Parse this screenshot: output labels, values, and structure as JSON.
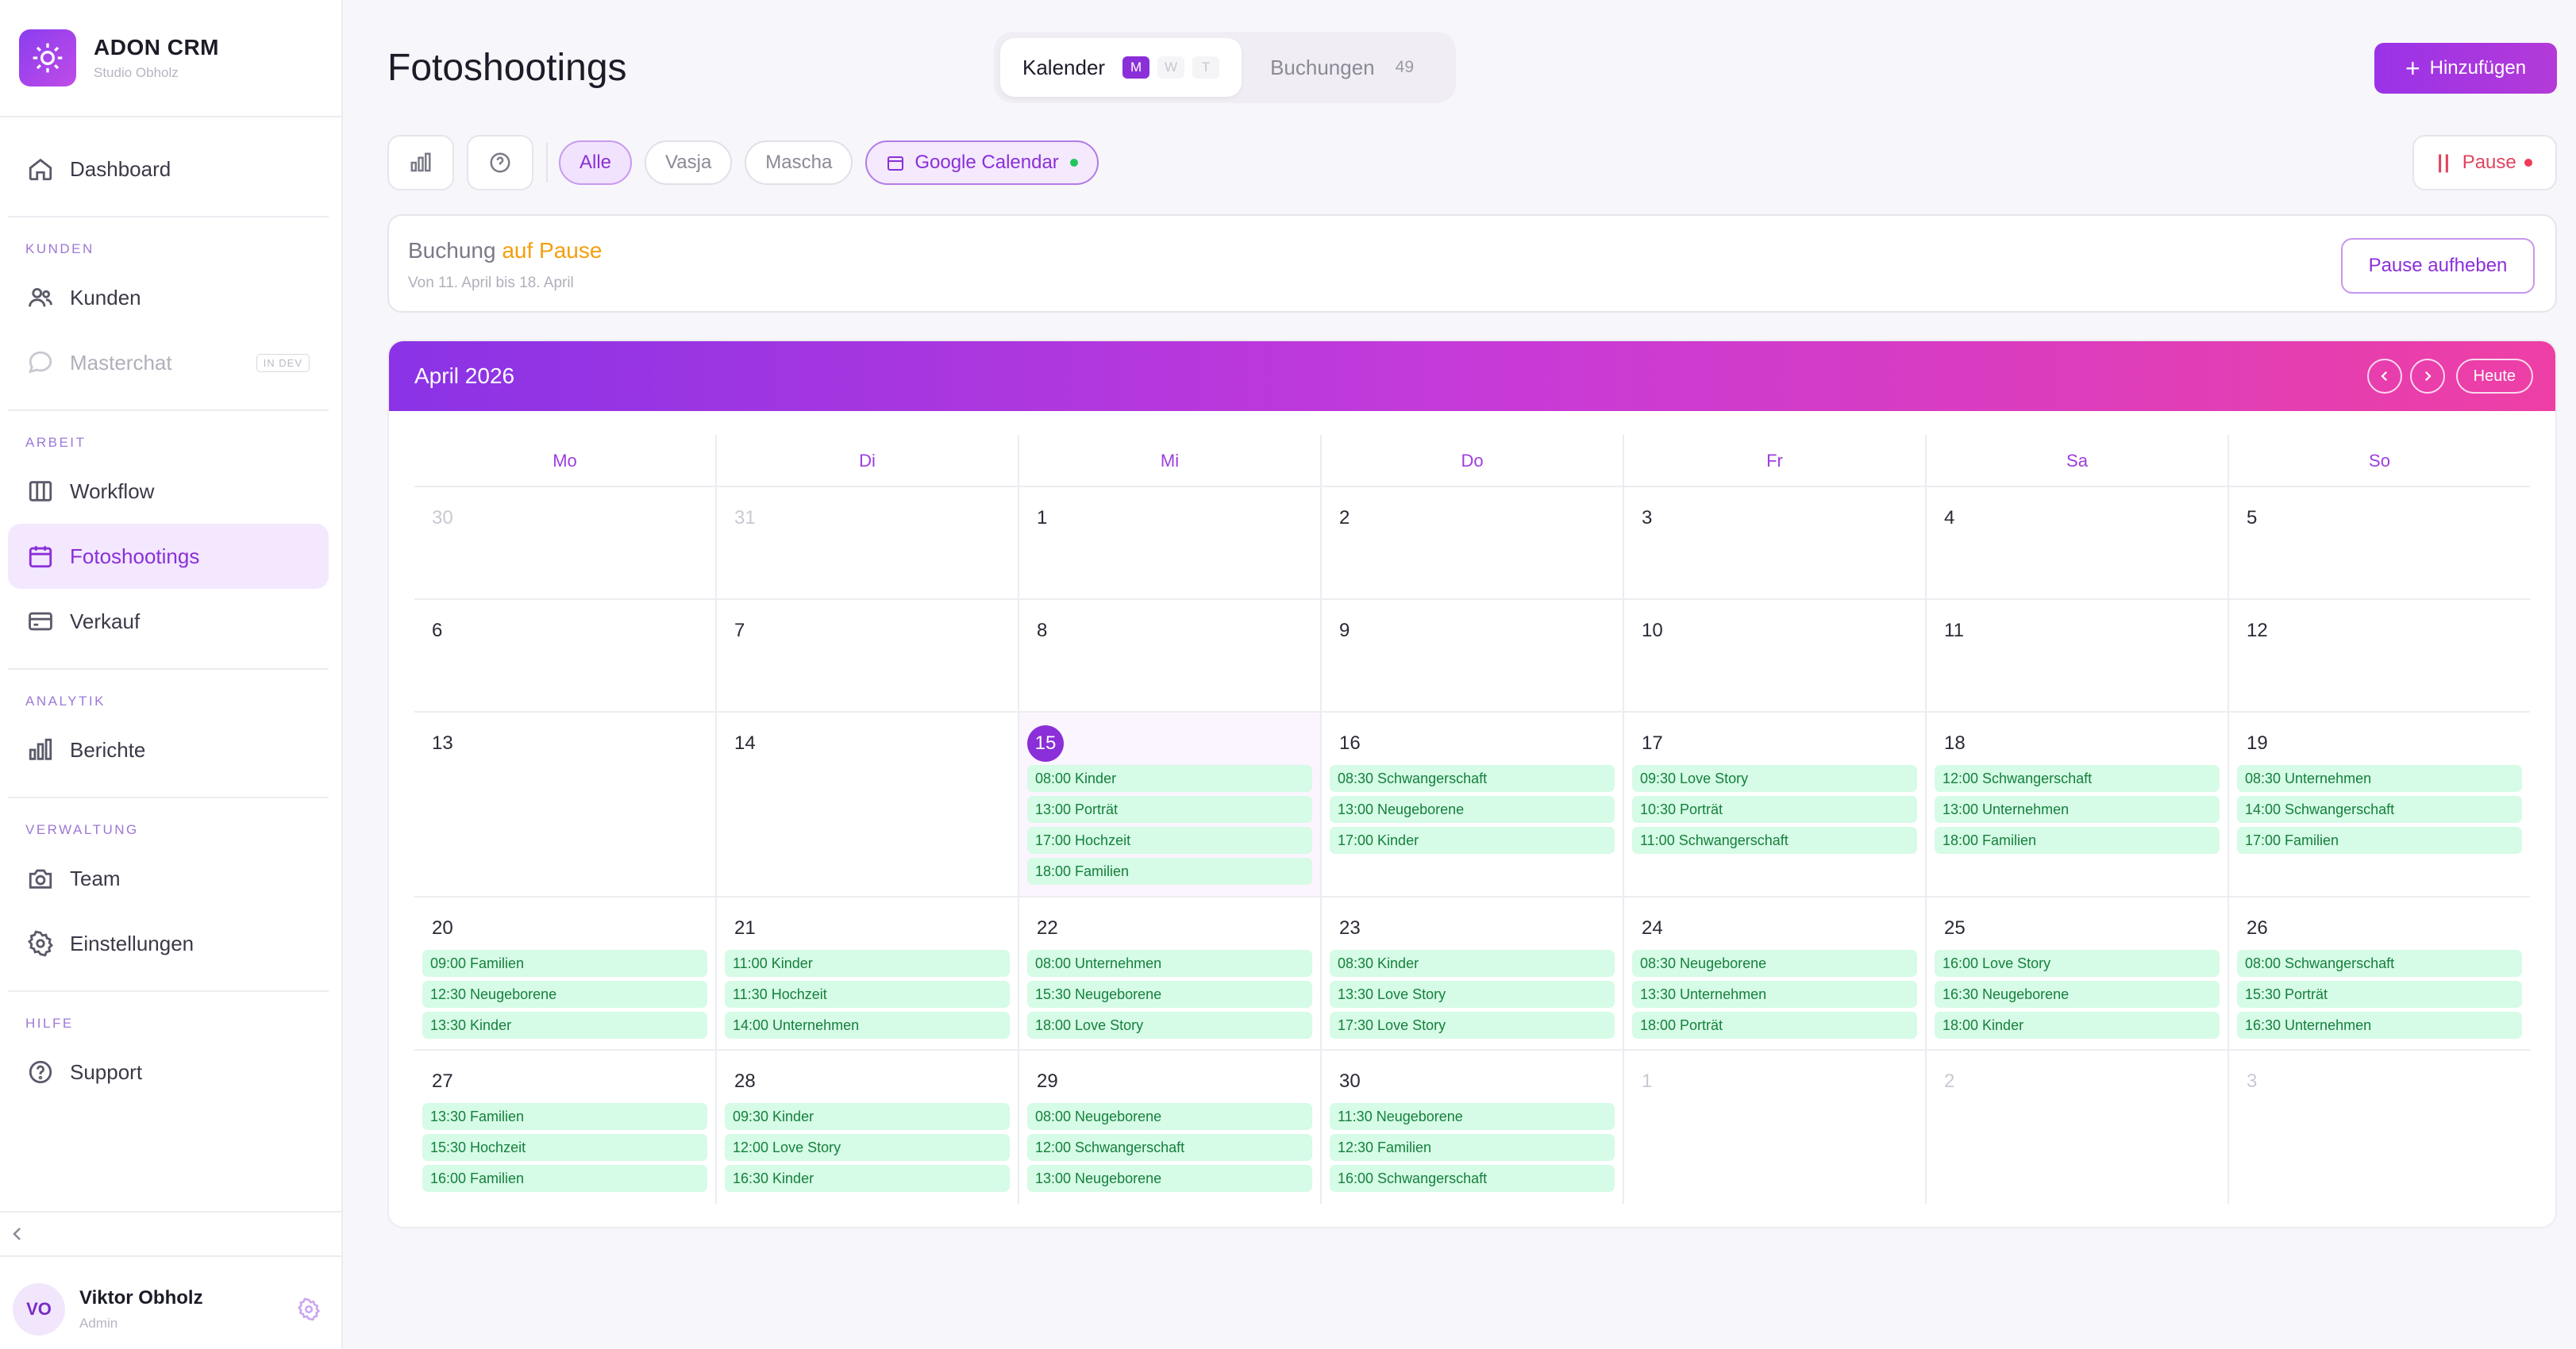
{
  "brand": {
    "title": "ADON CRM",
    "subtitle": "Studio Obholz"
  },
  "nav": {
    "dashboard": "Dashboard",
    "section_kunden": "KUNDEN",
    "kunden": "Kunden",
    "masterchat": "Masterchat",
    "masterchat_badge": "IN DEV",
    "section_arbeit": "ARBEIT",
    "workflow": "Workflow",
    "fotoshootings": "Fotoshootings",
    "verkauf": "Verkauf",
    "section_analytik": "ANALYTIK",
    "berichte": "Berichte",
    "section_verwaltung": "VERWALTUNG",
    "team": "Team",
    "einstellungen": "Einstellungen",
    "section_hilfe": "HILFE",
    "support": "Support"
  },
  "user": {
    "initials": "VO",
    "name": "Viktor Obholz",
    "role": "Admin"
  },
  "header": {
    "title": "Fotoshootings",
    "tab_calendar": "Kalender",
    "modes": [
      "M",
      "W",
      "T"
    ],
    "tab_bookings": "Buchungen",
    "bookings_count": "49",
    "add_button": "Hinzufügen"
  },
  "filters": {
    "all": "Alle",
    "vasja": "Vasja",
    "mascha": "Mascha",
    "gcal": "Google Calendar",
    "pause": "Pause"
  },
  "notice": {
    "prefix": "Buchung",
    "highlight": "auf Pause",
    "sub": "Von 11. April bis 18. April",
    "button": "Pause aufheben"
  },
  "calendar": {
    "month": "April 2026",
    "today_button": "Heute",
    "weekdays": [
      "Mo",
      "Di",
      "Mi",
      "Do",
      "Fr",
      "Sa",
      "So"
    ],
    "weeks": [
      [
        {
          "d": "30",
          "o": true,
          "ev": []
        },
        {
          "d": "31",
          "o": true,
          "ev": []
        },
        {
          "d": "1",
          "ev": []
        },
        {
          "d": "2",
          "ev": []
        },
        {
          "d": "3",
          "ev": []
        },
        {
          "d": "4",
          "ev": []
        },
        {
          "d": "5",
          "ev": []
        }
      ],
      [
        {
          "d": "6",
          "ev": []
        },
        {
          "d": "7",
          "ev": []
        },
        {
          "d": "8",
          "ev": []
        },
        {
          "d": "9",
          "ev": []
        },
        {
          "d": "10",
          "ev": []
        },
        {
          "d": "11",
          "ev": []
        },
        {
          "d": "12",
          "ev": []
        }
      ],
      [
        {
          "d": "13",
          "ev": []
        },
        {
          "d": "14",
          "ev": []
        },
        {
          "d": "15",
          "t": true,
          "ev": [
            "08:00 Kinder",
            "13:00 Porträt",
            "17:00 Hochzeit",
            "18:00 Familien"
          ]
        },
        {
          "d": "16",
          "ev": [
            "08:30 Schwangerschaft",
            "13:00 Neugeborene",
            "17:00 Kinder"
          ]
        },
        {
          "d": "17",
          "ev": [
            "09:30 Love Story",
            "10:30 Porträt",
            "11:00 Schwangerschaft"
          ]
        },
        {
          "d": "18",
          "ev": [
            "12:00 Schwangerschaft",
            "13:00 Unternehmen",
            "18:00 Familien"
          ]
        },
        {
          "d": "19",
          "ev": [
            "08:30 Unternehmen",
            "14:00 Schwangerschaft",
            "17:00 Familien"
          ]
        }
      ],
      [
        {
          "d": "20",
          "ev": [
            "09:00 Familien",
            "12:30 Neugeborene",
            "13:30 Kinder"
          ]
        },
        {
          "d": "21",
          "ev": [
            "11:00 Kinder",
            "11:30 Hochzeit",
            "14:00 Unternehmen"
          ]
        },
        {
          "d": "22",
          "ev": [
            "08:00 Unternehmen",
            "15:30 Neugeborene",
            "18:00 Love Story"
          ]
        },
        {
          "d": "23",
          "ev": [
            "08:30 Kinder",
            "13:30 Love Story",
            "17:30 Love Story"
          ]
        },
        {
          "d": "24",
          "ev": [
            "08:30 Neugeborene",
            "13:30 Unternehmen",
            "18:00 Porträt"
          ]
        },
        {
          "d": "25",
          "ev": [
            "16:00 Love Story",
            "16:30 Neugeborene",
            "18:00 Kinder"
          ]
        },
        {
          "d": "26",
          "ev": [
            "08:00 Schwangerschaft",
            "15:30 Porträt",
            "16:30 Unternehmen"
          ]
        }
      ],
      [
        {
          "d": "27",
          "ev": [
            "13:30 Familien",
            "15:30 Hochzeit",
            "16:00 Familien"
          ]
        },
        {
          "d": "28",
          "ev": [
            "09:30 Kinder",
            "12:00 Love Story",
            "16:30 Kinder"
          ]
        },
        {
          "d": "29",
          "ev": [
            "08:00 Neugeborene",
            "12:00 Schwangerschaft",
            "13:00 Neugeborene"
          ]
        },
        {
          "d": "30",
          "ev": [
            "11:30 Neugeborene",
            "12:30 Familien",
            "16:00 Schwangerschaft"
          ]
        },
        {
          "d": "1",
          "o": true,
          "ev": []
        },
        {
          "d": "2",
          "o": true,
          "ev": []
        },
        {
          "d": "3",
          "o": true,
          "ev": []
        }
      ]
    ]
  },
  "colors": {
    "accent": "#8b2fd9",
    "event_bg": "#d6fbe6",
    "event_text": "#15803d",
    "pause": "#f59e0b"
  }
}
